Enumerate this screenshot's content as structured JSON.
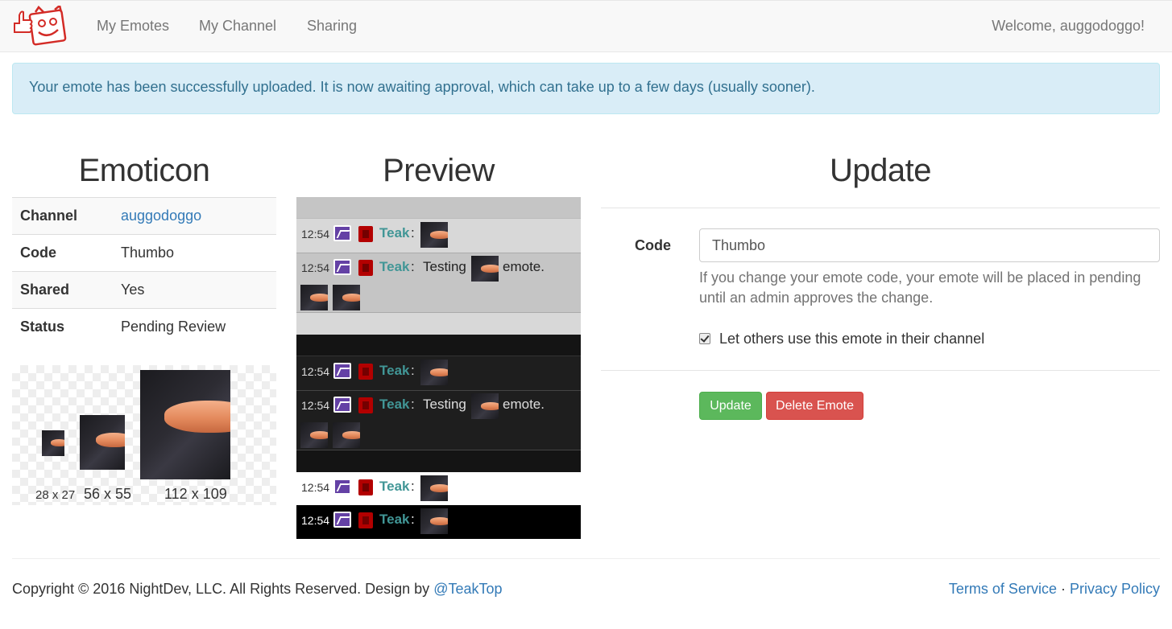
{
  "nav": {
    "links": [
      "My Emotes",
      "My Channel",
      "Sharing"
    ],
    "welcome": "Welcome, auggodoggo!"
  },
  "alert": {
    "message": "Your emote has been successfully uploaded. It is now awaiting approval, which can take up to a few days (usually sooner)."
  },
  "emoticon": {
    "heading": "Emoticon",
    "rows": [
      {
        "key": "Channel",
        "value": "auggodoggo"
      },
      {
        "key": "Code",
        "value": "Thumbo"
      },
      {
        "key": "Shared",
        "value": "Yes"
      },
      {
        "key": "Status",
        "value": "Pending Review"
      }
    ],
    "sizes": [
      "28 x 27",
      "56 x 55",
      "112 x 109"
    ]
  },
  "preview": {
    "heading": "Preview",
    "timestamp": "12:54",
    "nick": "Teak",
    "colon": ":",
    "msg_before": "Testing",
    "msg_after": "emote.",
    "colors": {
      "light_bg": "#d8d8d8",
      "light_alt": "#c5c5c5",
      "dark_bg": "#1e1e1e",
      "dark_alt": "#141414",
      "white_bg": "#ffffff",
      "black_bg": "#000000",
      "nick": "#419696"
    }
  },
  "update": {
    "heading": "Update",
    "code_label": "Code",
    "code_value": "Thumbo",
    "help_text": "If you change your emote code, your emote will be placed in pending until an admin approves the change.",
    "share_label": "Let others use this emote in their channel",
    "share_checked": true,
    "update_button": "Update",
    "delete_button": "Delete Emote"
  },
  "footer": {
    "copyright": "Copyright © 2016 NightDev, LLC. All Rights Reserved. Design by ",
    "designer_link": "@TeakTop",
    "terms": "Terms of Service",
    "separator": " · ",
    "privacy": "Privacy Policy"
  }
}
